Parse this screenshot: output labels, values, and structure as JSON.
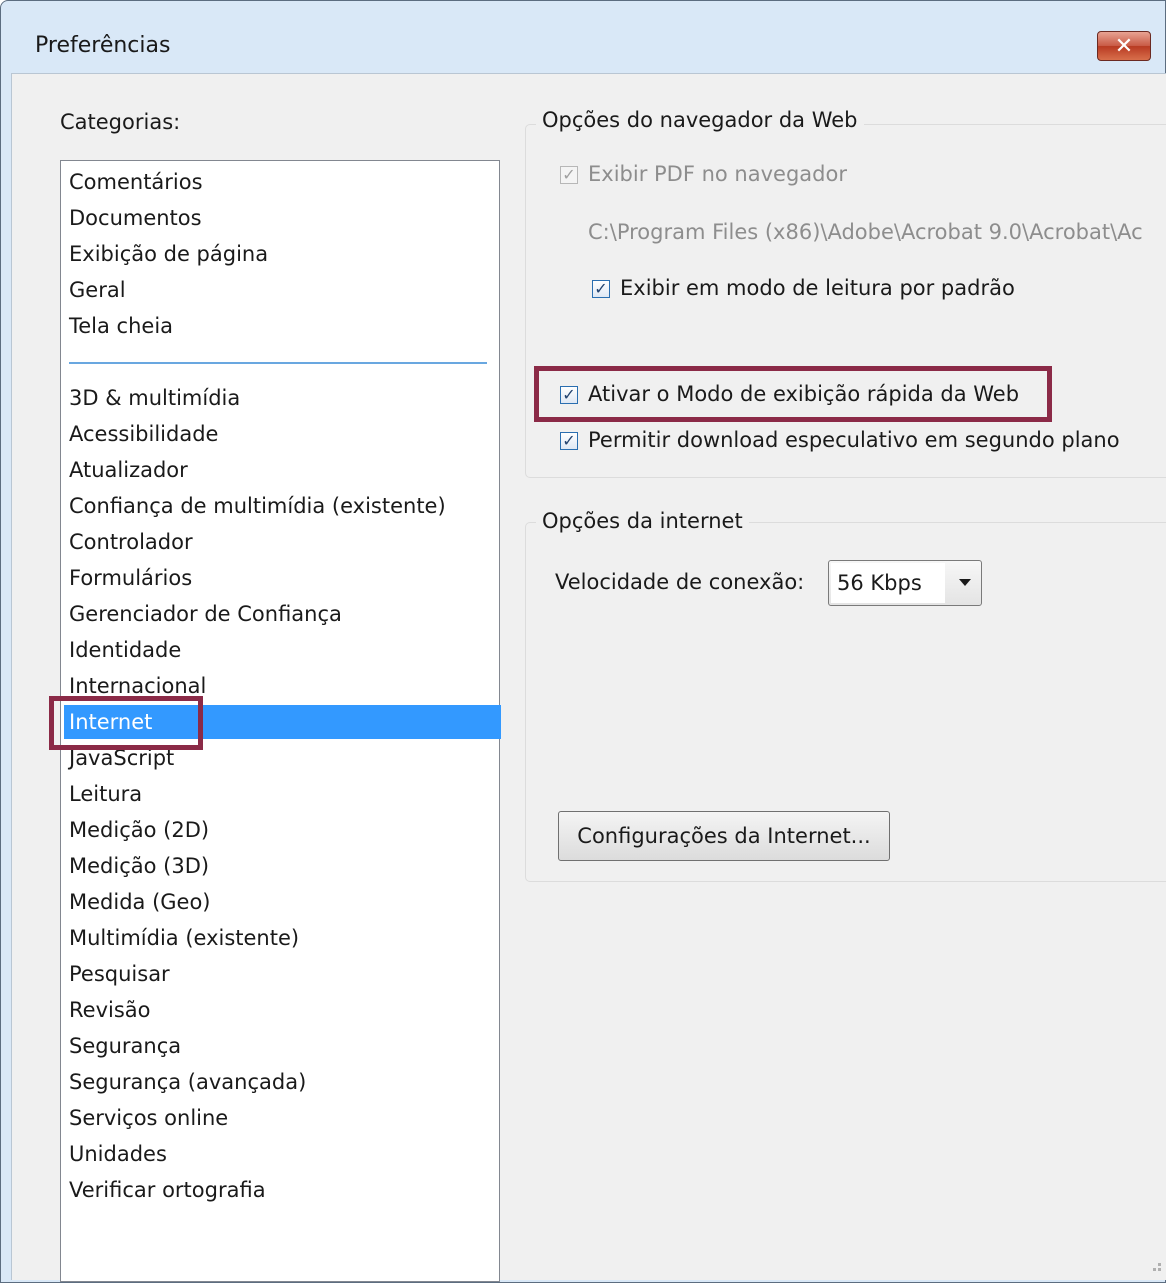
{
  "window": {
    "title": "Preferências",
    "close_label": "✕"
  },
  "categories": {
    "label": "Categorias:",
    "top_items": [
      "Comentários",
      "Documentos",
      "Exibição de página",
      "Geral",
      "Tela cheia"
    ],
    "items": [
      "3D & multimídia",
      "Acessibilidade",
      "Atualizador",
      "Confiança de multimídia (existente)",
      "Controlador",
      "Formulários",
      "Gerenciador de Confiança",
      "Identidade",
      "Internacional",
      "Internet",
      "JavaScript",
      "Leitura",
      "Medição (2D)",
      "Medição (3D)",
      "Medida (Geo)",
      "Multimídia (existente)",
      "Pesquisar",
      "Revisão",
      "Segurança",
      "Segurança (avançada)",
      "Serviços online",
      "Unidades",
      "Verificar ortografia"
    ],
    "selected": "Internet"
  },
  "browser_options": {
    "title": "Opções do navegador da Web",
    "show_pdf_in_browser": {
      "label": "Exibir PDF no navegador",
      "checked": true,
      "enabled": false
    },
    "plugin_path": "C:\\Program Files (x86)\\Adobe\\Acrobat 9.0\\Acrobat\\Ac",
    "reading_mode": {
      "label": "Exibir em modo de leitura por padrão",
      "checked": true
    },
    "fast_web_view": {
      "label": "Ativar o Modo de exibição rápida da Web",
      "checked": true
    },
    "speculative_download": {
      "label": "Permitir download especulativo em segundo plano",
      "checked": true
    }
  },
  "internet_options": {
    "title": "Opções da internet",
    "connection_speed_label": "Velocidade de conexão:",
    "connection_speed_value": "56 Kbps",
    "settings_button": "Configurações da Internet..."
  },
  "checkmark": "✓",
  "colors": {
    "selection": "#3399ff",
    "highlight_box": "#8b2a47"
  }
}
